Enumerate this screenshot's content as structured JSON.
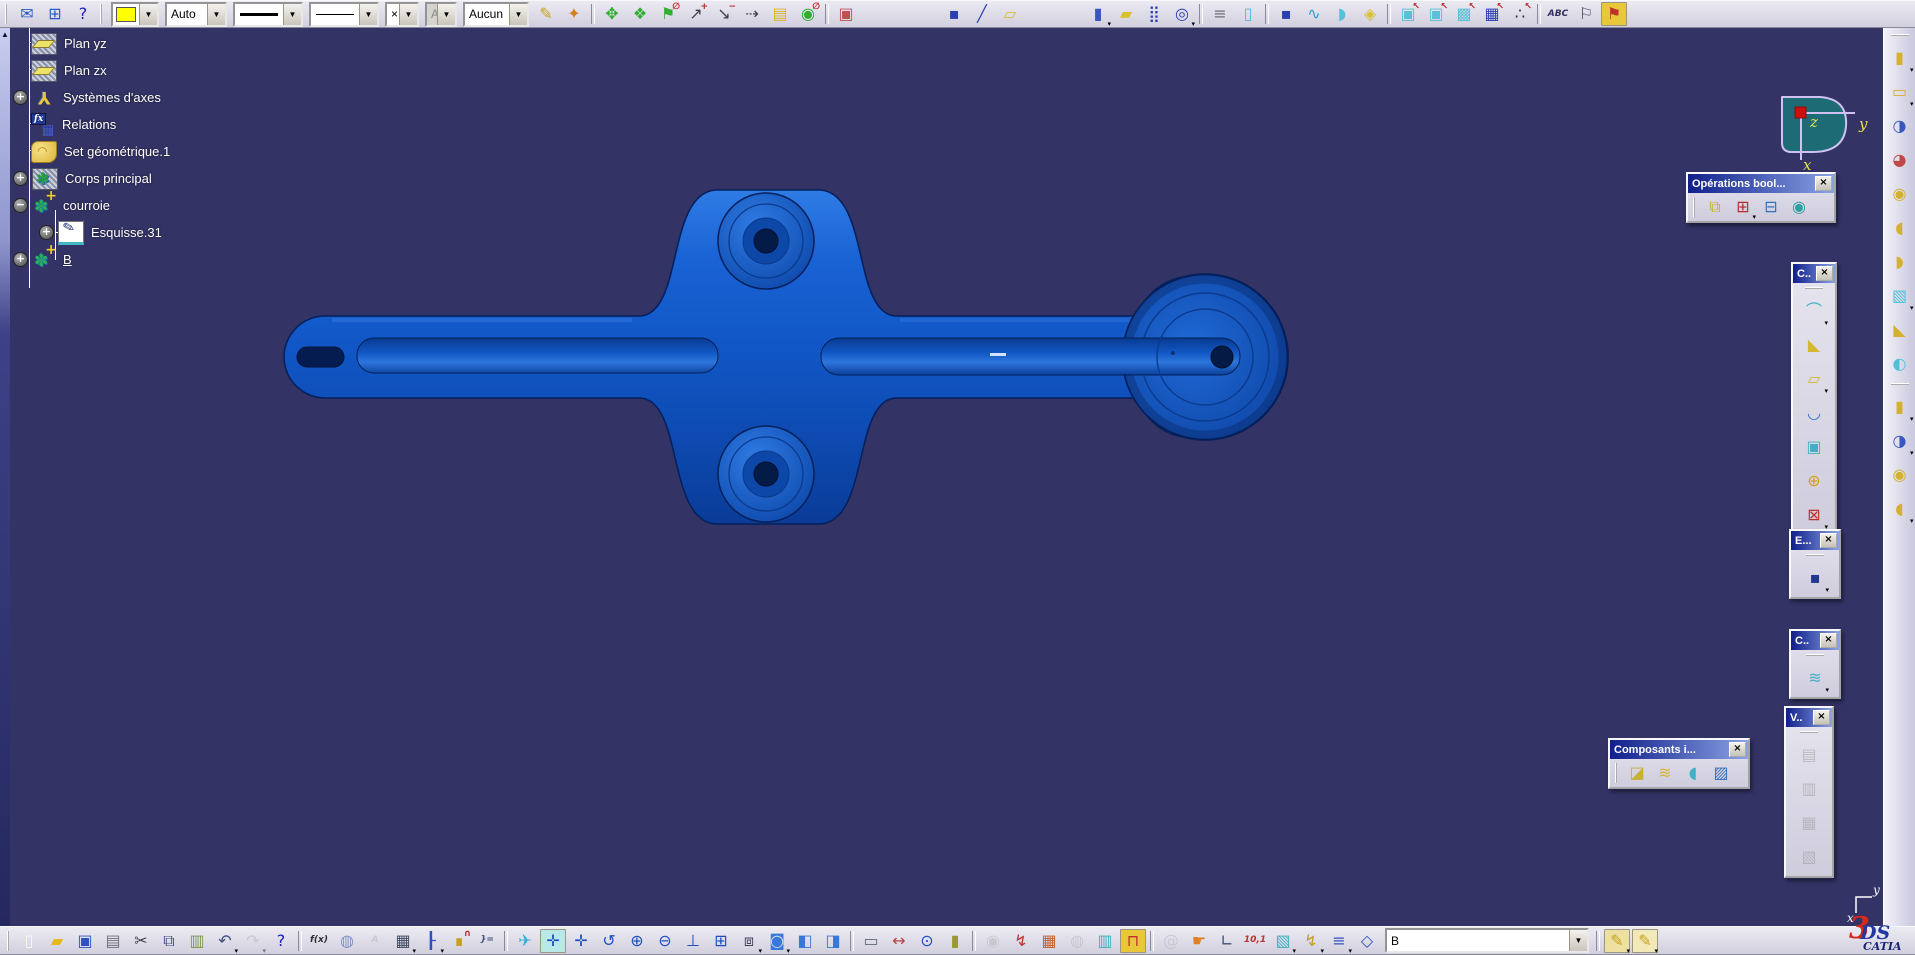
{
  "ui": {
    "dd_glyph": "▾",
    "combo_arrow": "▼",
    "close_glyph": "×",
    "scroll_up_glyph": "▲",
    "viewport_bg": "#333366",
    "part_blue": "#1157c8",
    "title_gradient_start": "#101f8a",
    "title_gradient_end": "#8aa2e4"
  },
  "top_toolbar": {
    "color_swatch": "#ffff00",
    "combos": {
      "style_value": "Auto",
      "point_symbol": "×",
      "auto_disabled_value": "Aut",
      "layer_value": "Aucun"
    },
    "group1": [
      {
        "handle": true
      },
      {
        "n": "send-icon",
        "g": "✉",
        "c": "#2b59c8"
      },
      {
        "n": "doc-group-icon",
        "g": "⊞",
        "c": "#2b59c8"
      },
      {
        "n": "whats-this-icon",
        "g": "?",
        "c": "#2020c0"
      },
      {
        "handle": true
      }
    ],
    "group2": [
      {
        "n": "painter-icon",
        "g": "✎",
        "c": "#caa21a"
      },
      {
        "n": "wizard-icon",
        "g": "✦",
        "c": "#d08020"
      },
      {
        "sep": true
      },
      {
        "n": "snap-icon",
        "g": "✥",
        "c": "#2fae2f"
      },
      {
        "n": "rotate-snap-icon",
        "g": "❖",
        "c": "#2fae2f"
      },
      {
        "n": "no-snap-icon",
        "g": "⚑",
        "c": "#2fae2f",
        "o": "∅"
      },
      {
        "n": "increment-plus-icon",
        "g": "↗",
        "c": "#404040",
        "o": "+"
      },
      {
        "n": "increment-minus-icon",
        "g": "↘",
        "c": "#404040",
        "o": "−"
      },
      {
        "n": "step-icon",
        "g": "⇢",
        "c": "#404040"
      },
      {
        "n": "list-pick-icon",
        "g": "▤",
        "c": "#d8b820"
      },
      {
        "n": "no-zoom-icon",
        "g": "◉",
        "c": "#2fae2f",
        "o": "∅"
      },
      {
        "sep": true
      },
      {
        "n": "catalog-icon",
        "g": "▣",
        "c": "#c05050"
      },
      {
        "sp": 80
      },
      {
        "n": "point-icon",
        "g": "▪",
        "c": "#2b3fb0"
      },
      {
        "n": "line-icon",
        "g": "╱",
        "c": "#2b3fb0"
      },
      {
        "n": "plane-icon",
        "g": "▱",
        "c": "#d8c030"
      },
      {
        "sp": 60
      },
      {
        "n": "extrude-icon",
        "g": "▮",
        "c": "#3b55c0",
        "dd": true
      },
      {
        "n": "planes-icon",
        "g": "▰",
        "c": "#d8c030"
      },
      {
        "n": "grid-points-icon",
        "g": "⣿",
        "c": "#2b3fb0"
      },
      {
        "n": "circle-pattern-icon",
        "g": "◎",
        "c": "#2b3fb0",
        "dd": true
      },
      {
        "sep": true
      },
      {
        "n": "stack-dim-icon",
        "g": "≡",
        "c": "#707070"
      },
      {
        "n": "box-dim-icon",
        "g": "▯",
        "c": "#58b8d8"
      },
      {
        "sep": true
      },
      {
        "n": "point2-icon",
        "g": "▪",
        "c": "#2b3fb0"
      },
      {
        "n": "curve-icon",
        "g": "∿",
        "c": "#2b9fd0"
      },
      {
        "n": "surface-icon",
        "g": "◗",
        "c": "#58c0d8"
      },
      {
        "n": "volume-icon",
        "g": "◈",
        "c": "#d8c030"
      },
      {
        "sep": true
      },
      {
        "n": "pick-face-icon",
        "g": "▣",
        "c": "#58c0d8",
        "o": "↖"
      },
      {
        "n": "pick-face2-icon",
        "g": "▣",
        "c": "#58c0d8",
        "o": "↖"
      },
      {
        "n": "pick-body-icon",
        "g": "▩",
        "c": "#58c0d8",
        "o": "↖"
      },
      {
        "n": "pick-grid-icon",
        "g": "▦",
        "c": "#2b3fb0",
        "o": "↖"
      },
      {
        "n": "pick-points-icon",
        "g": "∴",
        "c": "#303030",
        "o": "↖"
      },
      {
        "sep": true
      },
      {
        "n": "text-annotation-icon",
        "g": "ABC",
        "c": "#303060",
        "text": true
      },
      {
        "n": "flag-annotation-icon",
        "g": "⚐",
        "c": "#404060"
      },
      {
        "n": "hyperlink-icon",
        "g": "⚑",
        "c": "#c03030",
        "chip": "#e8c838"
      }
    ]
  },
  "tree": {
    "items": [
      {
        "label": "Plan yz",
        "icon": "plane",
        "level": 1
      },
      {
        "label": "Plan zx",
        "icon": "plane",
        "level": 1
      },
      {
        "label": "Systèmes d'axes",
        "icon": "axes",
        "level": 1,
        "exp": "+"
      },
      {
        "label": "Relations",
        "icon": "relations",
        "level": 1
      },
      {
        "label": "Set géométrique.1",
        "icon": "geoset",
        "level": 1
      },
      {
        "label": "Corps principal",
        "icon": "hatch",
        "level": 1,
        "exp": "+"
      },
      {
        "label": "courroie",
        "icon": "bplus",
        "level": 1,
        "exp": "−"
      },
      {
        "label": "Esquisse.31",
        "icon": "sketch",
        "level": 2,
        "exp": "+"
      },
      {
        "label": "B",
        "icon": "bplus",
        "level": 1,
        "exp": "+",
        "underline": true
      }
    ]
  },
  "compass": {
    "x": "x",
    "y": "y",
    "z": "z"
  },
  "axis_indicator": {
    "x": "x",
    "y": "y"
  },
  "panels": {
    "boolean": {
      "title": "Opérations bool...",
      "icons": [
        {
          "handle": true
        },
        {
          "n": "assemble-icon",
          "g": "⧉",
          "c": "#c8b030"
        },
        {
          "n": "add-body-icon",
          "g": "⊞",
          "c": "#b03030",
          "dd": true
        },
        {
          "n": "remove-body-icon",
          "g": "⊟",
          "c": "#3070c0"
        },
        {
          "n": "union-trim-icon",
          "g": "◉",
          "c": "#30a0a0"
        }
      ]
    },
    "dressup": {
      "title": "C..",
      "icons": [
        {
          "handle": true
        },
        {
          "n": "edge-fillet-icon",
          "g": "⌒",
          "c": "#40b0c8",
          "dd": true
        },
        {
          "n": "chamfer-icon",
          "g": "◣",
          "c": "#d4b832"
        },
        {
          "n": "draft-icon",
          "g": "▱",
          "c": "#d4b832",
          "dd": true
        },
        {
          "n": "shell-icon",
          "g": "◡",
          "c": "#3070c0"
        },
        {
          "n": "thickness-icon",
          "g": "▣",
          "c": "#40b0c8"
        },
        {
          "n": "thread-icon",
          "g": "⊕",
          "c": "#d4a020"
        },
        {
          "n": "remove-face-icon",
          "g": "⊠",
          "c": "#c03030",
          "dd": true
        }
      ]
    },
    "reference": {
      "title": "E...",
      "icons": [
        {
          "handle": true
        },
        {
          "n": "ref-point-icon",
          "g": "▪",
          "c": "#203890",
          "dd": true
        }
      ]
    },
    "surface1": {
      "title": "C..",
      "icons": [
        {
          "handle": true
        },
        {
          "n": "thick-surface-icon",
          "g": "≋",
          "c": "#40b0c8",
          "dd": true
        }
      ]
    },
    "views": {
      "title": "V..",
      "icons": [
        {
          "handle": true
        },
        {
          "n": "view-front-icon",
          "g": "▤",
          "c": "#909090",
          "dis": true
        },
        {
          "n": "view-section-icon",
          "g": "▥",
          "c": "#909090",
          "dis": true
        },
        {
          "n": "view-detail-icon",
          "g": "▦",
          "c": "#909090",
          "dis": true
        },
        {
          "n": "view-aux-icon",
          "g": "▧",
          "c": "#909090",
          "dis": true
        }
      ]
    },
    "surfcomp": {
      "title": "Composants i...",
      "icons": [
        {
          "handle": true
        },
        {
          "n": "split-icon",
          "g": "◪",
          "c": "#c8b030"
        },
        {
          "n": "thick-surface2-icon",
          "g": "≋",
          "c": "#d4b832"
        },
        {
          "n": "close-surface-icon",
          "g": "◖",
          "c": "#40b0c8"
        },
        {
          "n": "sew-surface-icon",
          "g": "▨",
          "c": "#3070c0"
        }
      ]
    }
  },
  "right_toolbar": {
    "icons": [
      {
        "handle": true
      },
      {
        "n": "pad-icon",
        "g": "▮",
        "c": "#d4b030",
        "dd": true
      },
      {
        "n": "pocket-icon",
        "g": "▭",
        "c": "#d4b030",
        "dd": true
      },
      {
        "n": "shaft-icon",
        "g": "◑",
        "c": "#3858c0"
      },
      {
        "n": "groove-icon",
        "g": "◕",
        "c": "#c04848"
      },
      {
        "n": "hole-icon",
        "g": "◉",
        "c": "#d4b030"
      },
      {
        "n": "rib-icon",
        "g": "◖",
        "c": "#d4b030"
      },
      {
        "n": "slot-icon",
        "g": "◗",
        "c": "#d4b030"
      },
      {
        "n": "solid-combine-icon",
        "g": "▧",
        "c": "#50c0d8",
        "dd": true
      },
      {
        "n": "stiffener-icon",
        "g": "◣",
        "c": "#d4b030"
      },
      {
        "n": "multi-section-icon",
        "g": "◐",
        "c": "#50c0d8"
      },
      {
        "handle": true
      },
      {
        "n": "pad2-icon",
        "g": "▮",
        "c": "#d4b030",
        "dd": true
      },
      {
        "n": "shaft2-icon",
        "g": "◑",
        "c": "#3858c0",
        "dd": true
      },
      {
        "n": "hole2-icon",
        "g": "◉",
        "c": "#d4b030"
      },
      {
        "n": "rib2-icon",
        "g": "◖",
        "c": "#d4b030",
        "dd": true
      }
    ]
  },
  "bottom_toolbar": {
    "filter_value": "B",
    "icons1": [
      {
        "handle": true
      },
      {
        "n": "new-icon",
        "g": "▯",
        "c": "#fdf8e4"
      },
      {
        "n": "open-icon",
        "g": "▰",
        "c": "#e8b820"
      },
      {
        "n": "save-icon",
        "g": "▣",
        "c": "#3050c0"
      },
      {
        "n": "print-icon",
        "g": "▤",
        "c": "#707080"
      },
      {
        "n": "cut-icon",
        "g": "✂",
        "c": "#404040"
      },
      {
        "n": "copy-icon",
        "g": "⧉",
        "c": "#405080"
      },
      {
        "n": "paste-icon",
        "g": "▥",
        "c": "#7a9a50"
      },
      {
        "n": "undo-icon",
        "g": "↶",
        "c": "#405080",
        "dd": true
      },
      {
        "n": "redo-icon",
        "g": "↷",
        "c": "#b0b0b0",
        "dis": true,
        "dd": true
      },
      {
        "n": "whats-this-icon",
        "g": "?",
        "c": "#2020c0"
      },
      {
        "sep": true
      },
      {
        "n": "formula-icon",
        "g": "f(x)",
        "c": "#303030",
        "text": true
      },
      {
        "n": "comment-icon",
        "g": "◍",
        "c": "#8090c8"
      },
      {
        "n": "text-disabled-icon",
        "g": "A",
        "c": "#b0b0b0",
        "text": true,
        "dis": true
      },
      {
        "n": "design-table-icon",
        "g": "▦",
        "c": "#404860",
        "dd": true
      },
      {
        "n": "tree-structure-icon",
        "g": "┠",
        "c": "#3050c0",
        "dd": true
      },
      {
        "n": "lock-icon",
        "g": "∎",
        "c": "#c8a020",
        "o": "∩"
      },
      {
        "n": "links-icon",
        "g": "}=",
        "c": "#405080",
        "text": true
      },
      {
        "sep": true
      },
      {
        "n": "fly-icon",
        "g": "✈",
        "c": "#40a8d8"
      },
      {
        "n": "fit-all-icon",
        "g": "✛",
        "c": "#2050c0",
        "chip": "#b8e8e8"
      },
      {
        "n": "pan-icon",
        "g": "✛",
        "c": "#2050c0"
      },
      {
        "n": "rotate-icon",
        "g": "↺",
        "c": "#2050c0"
      },
      {
        "n": "zoom-in-icon",
        "g": "⊕",
        "c": "#2050c0"
      },
      {
        "n": "zoom-out-icon",
        "g": "⊖",
        "c": "#2050c0"
      },
      {
        "n": "normal-view-icon",
        "g": "⊥",
        "c": "#2050c0"
      },
      {
        "n": "multi-view-icon",
        "g": "⊞",
        "c": "#2050c0"
      },
      {
        "n": "iso-view-icon",
        "g": "⧈",
        "c": "#404060",
        "dd": true
      },
      {
        "n": "render-style-icon",
        "g": "◙",
        "c": "#3878d8",
        "dd": true
      },
      {
        "n": "hide-show-icon",
        "g": "◧",
        "c": "#3878d8"
      },
      {
        "n": "swap-space-icon",
        "g": "◨",
        "c": "#3878d8"
      },
      {
        "sep": true
      },
      {
        "n": "measure-box-icon",
        "g": "▭",
        "c": "#606878"
      },
      {
        "n": "measure-between-icon",
        "g": "↔",
        "c": "#c04040"
      },
      {
        "n": "measure-item-icon",
        "g": "⊙",
        "c": "#2050c0"
      },
      {
        "n": "inertia-icon",
        "g": "▮",
        "c": "#9a9a30"
      },
      {
        "sep": true
      },
      {
        "n": "camera-icon",
        "g": "◉",
        "c": "#b0b0b0",
        "dis": true
      },
      {
        "n": "energy-icon",
        "g": "↯",
        "c": "#c03030"
      },
      {
        "n": "map-icon",
        "g": "▦",
        "c": "#c06030"
      },
      {
        "n": "globe-icon",
        "g": "◍",
        "c": "#b0b0b0",
        "dis": true
      },
      {
        "n": "section-icon",
        "g": "▥",
        "c": "#40b0c0"
      },
      {
        "n": "clamp-icon",
        "g": "⊓",
        "c": "#c03030",
        "chip": "#e8c838"
      },
      {
        "sep": true
      },
      {
        "n": "spiral-icon",
        "g": "@",
        "c": "#b0b0b0",
        "dis": true
      },
      {
        "n": "grab-icon",
        "g": "☛",
        "c": "#e08020"
      },
      {
        "n": "axis-system-icon",
        "g": "∟",
        "c": "#405080"
      },
      {
        "n": "dimension-toggle-icon",
        "g": "10,1",
        "c": "#c03030",
        "text": true
      },
      {
        "n": "box-analysis-icon",
        "g": "▧",
        "c": "#40b0c0",
        "dd": true
      },
      {
        "n": "constraint-icon",
        "g": "↯",
        "c": "#c0a020",
        "dd": true
      },
      {
        "n": "list-icon",
        "g": "≡",
        "c": "#3050c0",
        "dd": true
      },
      {
        "n": "gem-icon",
        "g": "◇",
        "c": "#3050c0"
      }
    ],
    "icons2": [
      {
        "sep": true
      },
      {
        "n": "catalog-edit-icon",
        "g": "✎",
        "c": "#c8a020",
        "chip": "#eee0a0",
        "dd": true
      },
      {
        "n": "catalog-copy-icon",
        "g": "✎",
        "c": "#c8a020",
        "chip": "#f2e8b8",
        "dd": true
      }
    ],
    "logo": {
      "three": "3",
      "ds": "DS",
      "catia": "CATIA"
    }
  }
}
